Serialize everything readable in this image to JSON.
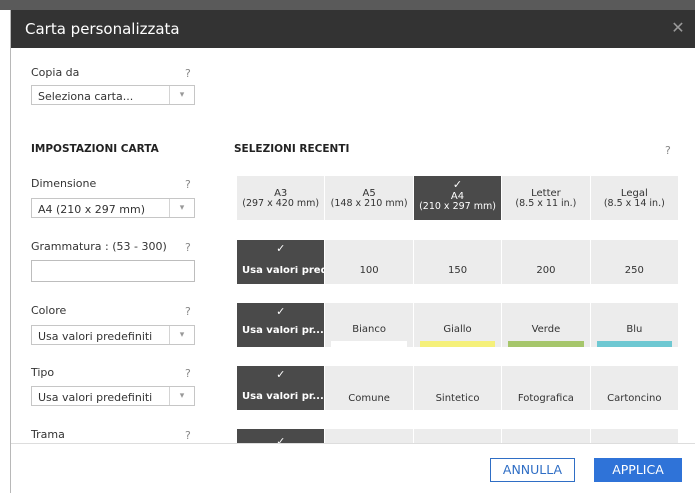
{
  "dialog": {
    "title": "Carta personalizzata",
    "close_icon": "close-icon"
  },
  "left": {
    "copy_from": {
      "label": "Copia da",
      "help": "?",
      "value": "Seleziona carta...",
      "arrow": "▾"
    },
    "section_title": "IMPOSTAZIONI CARTA",
    "size": {
      "label": "Dimensione",
      "help": "?",
      "value": "A4 (210 x 297 mm)",
      "arrow": "▾"
    },
    "weight": {
      "label": "Grammatura : (53 - 300)",
      "help": "?",
      "value": ""
    },
    "color": {
      "label": "Colore",
      "help": "?",
      "value": "Usa valori predefiniti",
      "arrow": "▾"
    },
    "type": {
      "label": "Tipo",
      "help": "?",
      "value": "Usa valori predefiniti",
      "arrow": "▾"
    },
    "texture": {
      "label": "Trama",
      "help": "?"
    }
  },
  "recent": {
    "title": "SELEZIONI RECENTI",
    "help": "?",
    "check": "✓",
    "size_row": [
      {
        "line1": "A3",
        "line2": "(297 x 420 mm)",
        "selected": false
      },
      {
        "line1": "A5",
        "line2": "(148 x 210 mm)",
        "selected": false
      },
      {
        "line1": "A4",
        "line2": "(210 x 297 mm)",
        "selected": true
      },
      {
        "line1": "Letter",
        "line2": "(8.5 x 11 in.)",
        "selected": false
      },
      {
        "line1": "Legal",
        "line2": "(8.5 x 14 in.)",
        "selected": false
      }
    ],
    "weight_row": [
      {
        "label": "Usa valori predefiniti",
        "selected": true
      },
      {
        "label": "100",
        "selected": false
      },
      {
        "label": "150",
        "selected": false
      },
      {
        "label": "200",
        "selected": false
      },
      {
        "label": "250",
        "selected": false
      }
    ],
    "color_row": [
      {
        "label": "Usa valori pr...",
        "selected": true,
        "color": ""
      },
      {
        "label": "Bianco",
        "selected": false,
        "color": "#ffffff"
      },
      {
        "label": "Giallo",
        "selected": false,
        "color": "#f5f07a"
      },
      {
        "label": "Verde",
        "selected": false,
        "color": "#a6c66b"
      },
      {
        "label": "Blu",
        "selected": false,
        "color": "#6ec8d2"
      }
    ],
    "type_row": [
      {
        "label": "Usa valori pr...",
        "selected": true
      },
      {
        "label": "Comune",
        "selected": false
      },
      {
        "label": "Sintetico",
        "selected": false
      },
      {
        "label": "Fotografica",
        "selected": false
      },
      {
        "label": "Cartoncino",
        "selected": false
      }
    ]
  },
  "footer": {
    "cancel": "ANNULLA",
    "apply": "APPLICA"
  }
}
